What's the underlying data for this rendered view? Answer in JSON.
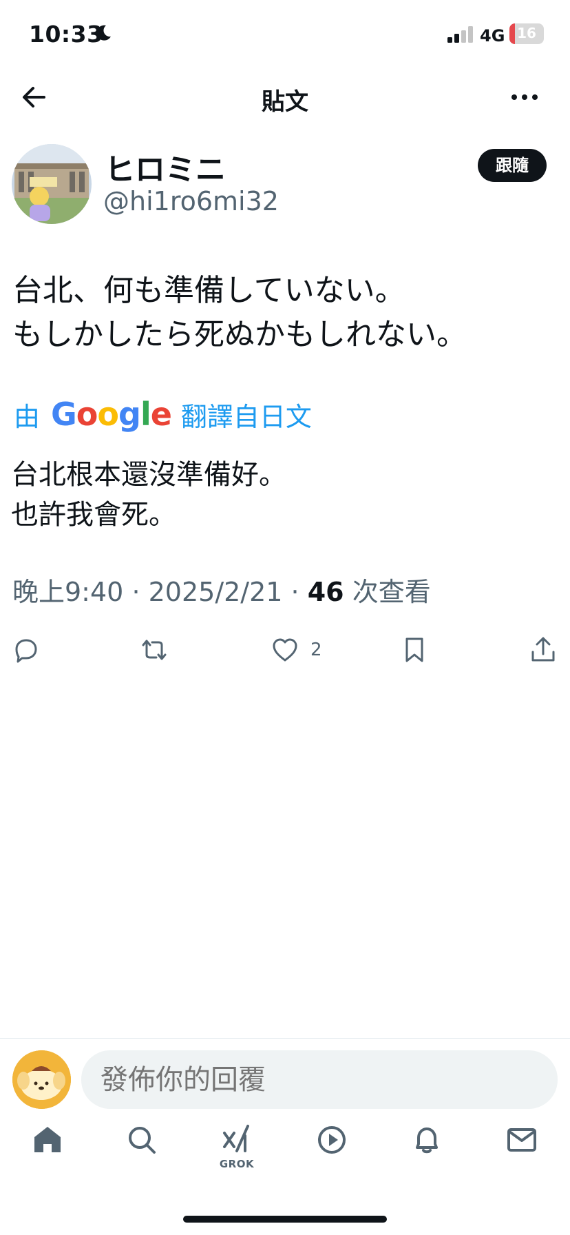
{
  "status_bar": {
    "time": "10:33",
    "network": "4G",
    "battery_level": "16",
    "battery_fraction": 0.16,
    "battery_color": "#e5484d"
  },
  "header": {
    "title": "貼文"
  },
  "post": {
    "author": {
      "display_name": "ヒロミニ",
      "handle": "@hi1ro6mi32"
    },
    "follow_label": "跟隨",
    "text": "台北、何も準備していない。\nもしかしたら死ぬかもしれない。",
    "translation": {
      "prefix": "由",
      "provider": "Google",
      "suffix": "翻譯自日文",
      "text": "台北根本還沒準備好。\n也許我會死。"
    },
    "meta": {
      "time": "晚上9:40",
      "date": "2025/2/21",
      "views": "46",
      "views_label": "次查看"
    },
    "actions": {
      "like_count": "2"
    }
  },
  "reply_bar": {
    "placeholder": "發佈你的回覆"
  },
  "tabbar": {
    "grok_label": "GROK"
  },
  "colors": {
    "accent": "#1d9bf0",
    "text": "#0f1419",
    "muted": "#536471"
  }
}
